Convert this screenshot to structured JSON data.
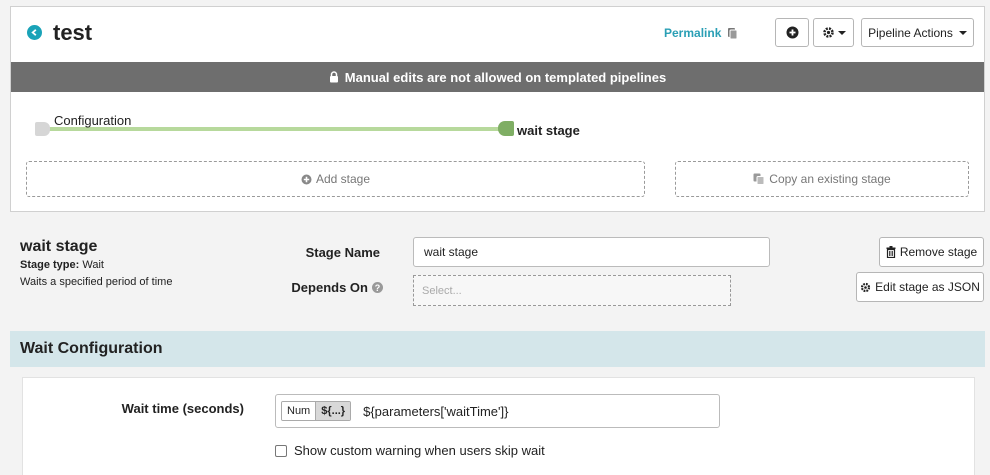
{
  "header": {
    "title": "test",
    "permalink": "Permalink",
    "pipeline_actions": "Pipeline Actions"
  },
  "banner": {
    "text": "Manual edits are not allowed on templated pipelines"
  },
  "graph": {
    "nodes": [
      {
        "label": "Configuration"
      },
      {
        "label": "wait stage"
      }
    ],
    "add_stage": "Add stage",
    "copy_stage": "Copy an existing stage"
  },
  "stage": {
    "title": "wait stage",
    "type_label": "Stage type:",
    "type_value": "Wait",
    "description": "Waits a specified period of time",
    "name_label": "Stage Name",
    "name_value": "wait stage",
    "depends_label": "Depends On",
    "depends_placeholder": "Select...",
    "remove_button": "Remove stage",
    "json_button": "Edit stage as JSON"
  },
  "wait_config": {
    "section_title": "Wait Configuration",
    "wait_label": "Wait time (seconds)",
    "toggle_num": "Num",
    "toggle_expr": "${...}",
    "wait_value": "${parameters['waitTime']}",
    "skip_warning_label": "Show custom warning when users skip wait"
  },
  "colors": {
    "accent": "#1aa3b8",
    "banner": "#6e6e6e",
    "graph_line": "#b7d99c",
    "active_node": "#7fae64",
    "section_head": "#d4e6ea"
  },
  "icons": {
    "back": "arrow-left-circle-icon",
    "copy": "clipboard-icon",
    "add": "plus-circle-icon",
    "gear": "gear-icon",
    "lock": "lock-icon",
    "trash": "trash-icon",
    "edit": "gear-icon",
    "help": "question-circle-icon"
  }
}
